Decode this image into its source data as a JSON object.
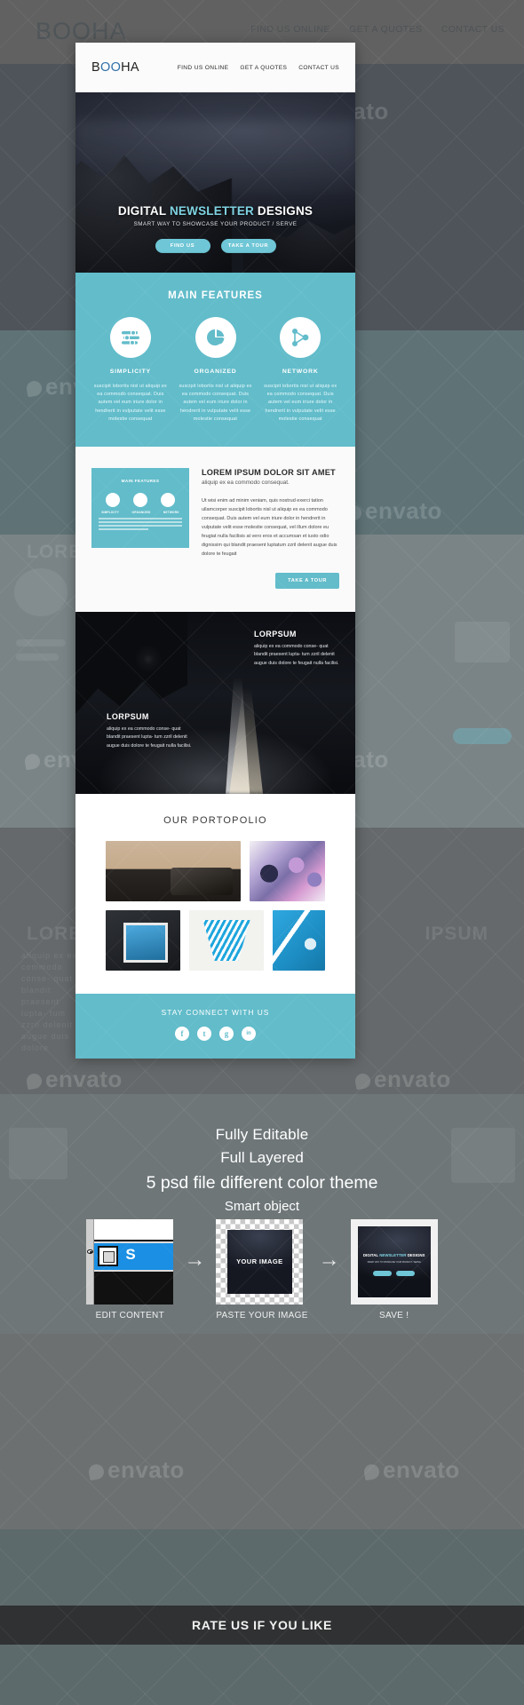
{
  "background": {
    "logo": "BOOHA",
    "nav": [
      "FIND US ONLINE",
      "GET A QUOTES",
      "CONTACT US"
    ],
    "ghost_title_1": "LOREM IPSUM DOLOR SIT AMET",
    "ghost_title_2": "LOREM",
    "ghost_title_3": "IPSUM",
    "ghost_body": "aliquip ex ea commodo conse- quat blandit praesent lupta- tum zzril delenit augue duis dolore",
    "watermark": "envato"
  },
  "newsletter": {
    "header": {
      "logo_prefix": "B",
      "logo_accent": "OO",
      "logo_suffix": "HA",
      "nav": [
        {
          "label": "FIND US ONLINE"
        },
        {
          "label": "GET A QUOTES"
        },
        {
          "label": "CONTACT US"
        }
      ]
    },
    "hero": {
      "title_part1": "DIGITAL ",
      "title_accent": "NEWSLETTER",
      "title_part2": " DESIGNS",
      "subtitle": "SMART WAY TO SHOWCASE YOUR PRODUCT / SERVE",
      "buttons": [
        {
          "label": "FIND US"
        },
        {
          "label": "TAKE A TOUR"
        }
      ]
    },
    "features": {
      "heading": "MAIN FEATURES",
      "items": [
        {
          "icon": "sliders-icon",
          "title": "SIMPLICITY",
          "body": "suscipit lobortis nisl ut aliquip ex ea commodo consequat. Duis autem vel eum iriure dolor in hendrerit in vulputate velit esse molestie consequat"
        },
        {
          "icon": "pie-chart-icon",
          "title": "ORGANIZED",
          "body": "suscipit lobortis nisl ut aliquip ex ea commodo consequat. Duis autem vel eum iriure dolor in hendrerit in vulputate velit esse molestie consequat"
        },
        {
          "icon": "network-icon",
          "title": "NETWORK",
          "body": "suscipit lobortis nisl ut aliquip ex ea commodo consequat. Duis autem vel eum iriure dolor in hendrerit in vulputate velit esse molestie consequat"
        }
      ]
    },
    "article": {
      "thumb_title": "MAIN FEATURES",
      "thumb_labels": [
        "SIMPLICITY",
        "ORGANIZED",
        "NETWORK"
      ],
      "title": "LOREM IPSUM DOLOR SIT AMET",
      "subtitle": "aliquip ex ea commodo consequat.",
      "body": "Ut wisi enim ad minim veniam, quis nostrud exerci tation ullamcorper suscipit lobortis nisl ut aliquip ex ea commodo consequat. Duis autem vel eum iriure dolor in hendrerit in vulputate velit esse molestie consequat, vel illum dolore eu feugiat nulla facilisis at vero eros et accumsan et iusto odio dignissim qui blandit praesent luptatum zzril delenit augue duis dolore te feugait",
      "button": "TAKE A TOUR"
    },
    "split": {
      "top": {
        "title": "LORPSUM",
        "body": "aliquip ex ea commodo conse- quat blandit praesent lupta- tum zzril delenit augue duis dolore te feugait nulla facilisi."
      },
      "bottom": {
        "title": "LORPSUM",
        "body": "aliquip ex ea commodo conse- quat blandit praesent lupta- tum zzril delenit augue duis dolore te feugait nulla facilisi."
      }
    },
    "portfolio": {
      "heading": "OUR PORTOPOLIO",
      "items": [
        {
          "alt": "vintage-camera-photo"
        },
        {
          "alt": "umbrellas-photo"
        },
        {
          "alt": "instant-photo-print"
        },
        {
          "alt": "blue-fan-object"
        },
        {
          "alt": "blue-business-card"
        }
      ]
    },
    "social": {
      "heading": "STAY CONNECT WITH US",
      "icons": [
        {
          "name": "facebook-icon",
          "glyph": "f"
        },
        {
          "name": "twitter-icon",
          "glyph": "t"
        },
        {
          "name": "google-plus-icon",
          "glyph": "g"
        },
        {
          "name": "linkedin-icon",
          "glyph": "in"
        }
      ]
    }
  },
  "promo": {
    "line1": "Fully Editable",
    "line2": "Full Layered",
    "line3": "5 psd file different color theme",
    "line4": "Smart object",
    "steps": [
      {
        "caption": "EDIT  CONTENT",
        "thumb": "photoshop-layers-panel"
      },
      {
        "caption": "PASTE YOUR IMAGE",
        "thumb": "checkerboard-placeholder",
        "overlay": "YOUR IMAGE"
      },
      {
        "caption": "SAVE !",
        "thumb": "saved-newsletter-preview"
      }
    ],
    "arrow": "→",
    "save_preview": {
      "title_part1": "DIGITAL ",
      "title_accent": "NEWSLETTER",
      "title_part2": " DESIGNS",
      "subtitle": "SMART WAY TO SHOWCASE YOUR PRODUCT / SERVE"
    }
  },
  "rate_bar": {
    "text": "RATE US IF YOU LIKE"
  },
  "colors": {
    "accent_teal": "#62bcca",
    "hero_accent": "#7fd3e2",
    "dark_bar": "#2f3132",
    "logo_blue": "#2f6fa8"
  }
}
